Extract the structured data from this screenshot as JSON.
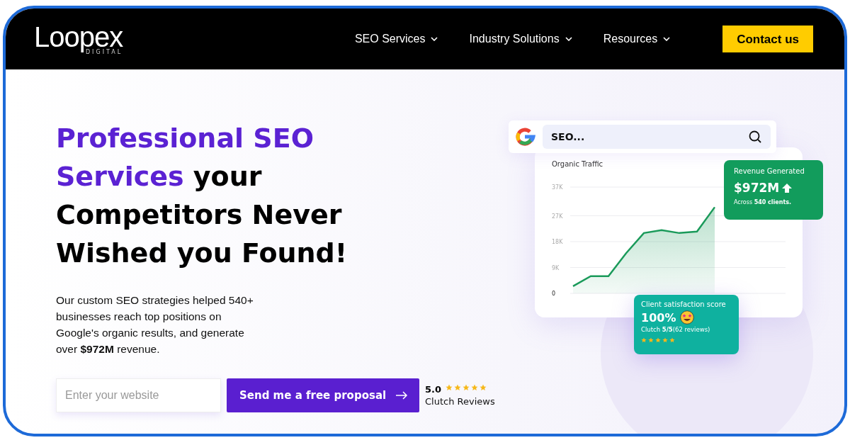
{
  "header": {
    "logo": {
      "name": "Loopex",
      "tagline": "DIGITAL"
    },
    "nav": [
      {
        "label": "SEO Services",
        "has_menu": true
      },
      {
        "label": "Industry Solutions",
        "has_menu": true
      },
      {
        "label": "Resources",
        "has_menu": true
      }
    ],
    "cta": "Contact us"
  },
  "hero": {
    "heading_highlight": "Professional SEO Services",
    "heading_rest": "your Competitors Never Wished you Found!",
    "description": "Our custom SEO strategies helped 540+ businesses reach top positions on Google's organic results, and generate over **$972M** revenue.",
    "website_field": {
      "placeholder": "Enter your website"
    },
    "submit": "Send me a free proposal",
    "rating": {
      "score": "5.0",
      "stars": 5,
      "label": "Clutch Reviews"
    }
  },
  "illustration": {
    "search": {
      "value": "SEO..."
    },
    "traffic_card": {
      "chart_data": {
        "type": "area",
        "ylim": [
          0,
          37
        ],
        "yticks": [
          {
            "value": 0,
            "label": "0"
          },
          {
            "value": 9,
            "label": "9K"
          },
          {
            "value": 18,
            "label": "18K"
          },
          {
            "value": 27,
            "label": "27K"
          },
          {
            "value": 37,
            "label": "37K"
          }
        ],
        "grid": true,
        "series": [
          {
            "name": "Organic Traffic",
            "color": "#1a9a5a",
            "values": [
              2.5,
              6,
              6,
              14,
              21,
              22,
              21,
              21.5,
              30,
              null,
              null
            ]
          }
        ]
      }
    },
    "revenue_card": {
      "title": "Revenue Generated",
      "value": "$972M",
      "note": "Across **540 clients.**"
    },
    "satisfaction_card": {
      "title": "Client satisfaction score",
      "value": "100%",
      "note": "Clutch **5/5**(62 reviews)",
      "stars": 5
    }
  }
}
